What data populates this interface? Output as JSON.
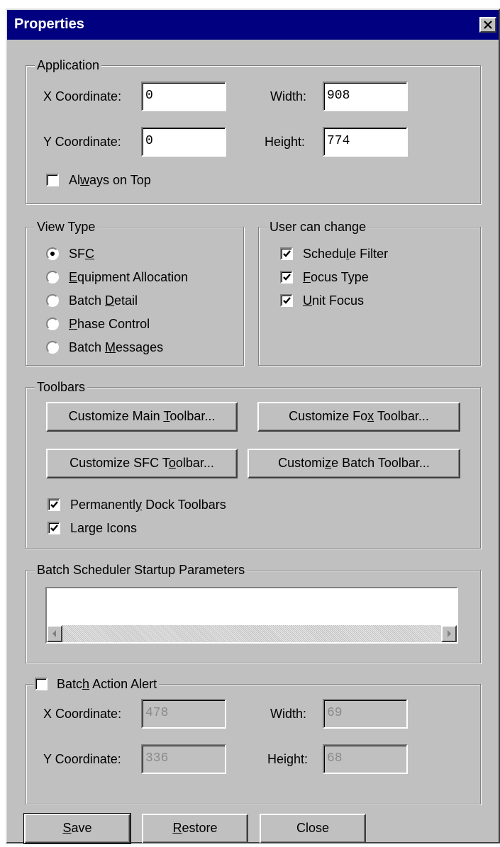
{
  "window": {
    "title": "Properties"
  },
  "application": {
    "group_label": "Application",
    "x_label": "X Coordinate:",
    "x_value": "0",
    "y_label": "Y Coordinate:",
    "y_value": "0",
    "width_label": "Width:",
    "width_value": "908",
    "height_label": "Height:",
    "height_value": "774",
    "always_on_top": {
      "pre": "Al",
      "key": "w",
      "post": "ays on Top",
      "checked": false
    }
  },
  "view_type": {
    "group_label": "View Type",
    "options": [
      {
        "pre": "SF",
        "key": "C",
        "post": "",
        "selected": true
      },
      {
        "pre": "",
        "key": "E",
        "post": "quipment Allocation",
        "selected": false
      },
      {
        "pre": "Batch ",
        "key": "D",
        "post": "etail",
        "selected": false
      },
      {
        "pre": "",
        "key": "P",
        "post": "hase Control",
        "selected": false
      },
      {
        "pre": "Batch ",
        "key": "M",
        "post": "essages",
        "selected": false
      }
    ]
  },
  "user_can_change": {
    "group_label": "User can change",
    "items": [
      {
        "pre": "Schedu",
        "key": "l",
        "post": "e Filter",
        "checked": true
      },
      {
        "pre": "",
        "key": "F",
        "post": "ocus Type",
        "checked": true
      },
      {
        "pre": "",
        "key": "U",
        "post": "nit Focus",
        "checked": true
      }
    ]
  },
  "toolbars": {
    "group_label": "Toolbars",
    "buttons": [
      {
        "pre": "Customize Main ",
        "key": "T",
        "post": "oolbar..."
      },
      {
        "pre": "Customize Fo",
        "key": "x",
        "post": " Toolbar..."
      },
      {
        "pre": "Customize SFC T",
        "key": "o",
        "post": "olbar..."
      },
      {
        "pre": "Customi",
        "key": "z",
        "post": "e Batch Toolbar..."
      }
    ],
    "permanently_dock": {
      "pre": "Permanentl",
      "key": "y",
      "post": " Dock Toolbars",
      "checked": true
    },
    "large_icons": {
      "pre": "Large Icons",
      "key": "",
      "post": "",
      "checked": true
    }
  },
  "scheduler": {
    "group_label": "Batch Scheduler Startup Parameters",
    "value": ""
  },
  "batch_action_alert": {
    "label": {
      "pre": "Batc",
      "key": "h",
      "post": " Action Alert",
      "checked": false
    },
    "x_label": "X Coordinate:",
    "x_value": "478",
    "y_label": "Y Coordinate:",
    "y_value": "336",
    "width_label": "Width:",
    "width_value": "69",
    "height_label": "Height:",
    "height_value": "68"
  },
  "footer": {
    "save": {
      "pre": "",
      "key": "S",
      "post": "ave"
    },
    "restore": {
      "pre": "",
      "key": "R",
      "post": "estore"
    },
    "close": {
      "pre": "Close",
      "key": "",
      "post": ""
    }
  },
  "colors": {
    "titlebar": "#000080",
    "face": "#c0c0c0",
    "disabled_text": "#8a8a8a"
  },
  "icons": {
    "close": "close-x-icon",
    "check": "checkmark-icon",
    "scroll_left": "arrow-left-icon",
    "scroll_right": "arrow-right-icon"
  }
}
